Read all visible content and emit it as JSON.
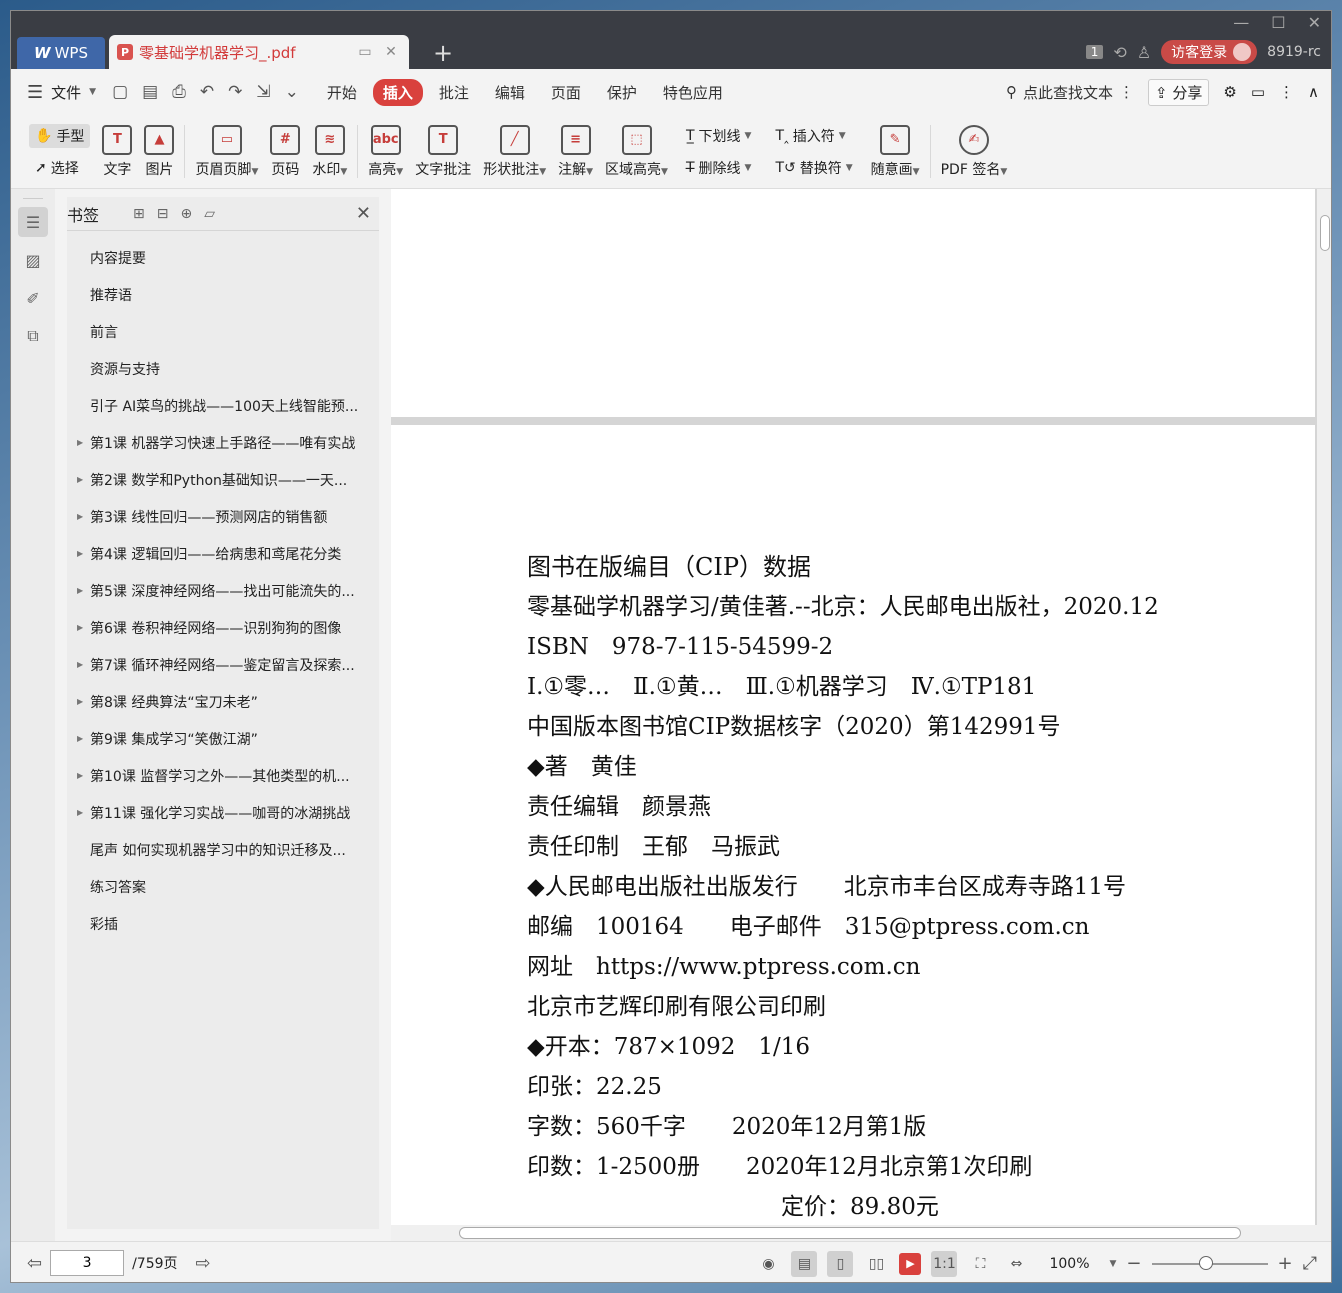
{
  "titlebar": {
    "app_tab": "WPS",
    "doc_tab": "零基础学机器学习_.pdf",
    "badge": "1",
    "login": "访客登录",
    "version": "8919-rc"
  },
  "menubar": {
    "file": "文件",
    "tabs": [
      "开始",
      "插入",
      "批注",
      "编辑",
      "页面",
      "保护",
      "特色应用"
    ],
    "active_tab": "插入",
    "search": "点此查找文本",
    "share": "分享"
  },
  "ribbon": {
    "hand": "手型",
    "select": "选择",
    "text": "文字",
    "image": "图片",
    "header_footer": "页眉页脚",
    "page_num": "页码",
    "watermark": "水印",
    "highlight": "高亮",
    "text_annot": "文字批注",
    "shape_annot": "形状批注",
    "note": "注解",
    "area_highlight": "区域高亮",
    "underline": "下划线",
    "strikethrough": "删除线",
    "insert_char": "插入符",
    "replace_char": "替换符",
    "freehand": "随意画",
    "pdf_sign": "PDF 签名"
  },
  "bookmarks": {
    "title": "书签",
    "items": [
      {
        "label": "内容提要",
        "expand": false
      },
      {
        "label": "推荐语",
        "expand": false
      },
      {
        "label": "前言",
        "expand": false
      },
      {
        "label": "资源与支持",
        "expand": false
      },
      {
        "label": "引子 AI菜鸟的挑战——100天上线智能预...",
        "expand": false
      },
      {
        "label": "第1课 机器学习快速上手路径——唯有实战",
        "expand": true
      },
      {
        "label": "第2课 数学和Python基础知识——一天...",
        "expand": true
      },
      {
        "label": "第3课 线性回归——预测网店的销售额",
        "expand": true
      },
      {
        "label": "第4课 逻辑回归——给病患和鸢尾花分类",
        "expand": true
      },
      {
        "label": "第5课 深度神经网络——找出可能流失的...",
        "expand": true
      },
      {
        "label": "第6课 卷积神经网络——识别狗狗的图像",
        "expand": true
      },
      {
        "label": "第7课 循环神经网络——鉴定留言及探索...",
        "expand": true
      },
      {
        "label": "第8课 经典算法“宝刀未老”",
        "expand": true
      },
      {
        "label": "第9课 集成学习“笑傲江湖”",
        "expand": true
      },
      {
        "label": "第10课 监督学习之外——其他类型的机...",
        "expand": true
      },
      {
        "label": "第11课 强化学习实战——咖哥的冰湖挑战",
        "expand": true
      },
      {
        "label": "尾声 如何实现机器学习中的知识迁移及...",
        "expand": false
      },
      {
        "label": "练习答案",
        "expand": false
      },
      {
        "label": "彩插",
        "expand": false
      }
    ]
  },
  "document": {
    "lines": [
      "图书在版编目（CIP）数据",
      "零基础学机器学习/黄佳著.--北京：人民邮电出版社，2020.12",
      "ISBN　978-7-115-54599-2",
      "Ⅰ.①零…　Ⅱ.①黄…　Ⅲ.①机器学习　Ⅳ.①TP181",
      "中国版本图书馆CIP数据核字（2020）第142991号",
      "◆著　黄佳",
      "责任编辑　颜景燕",
      "责任印制　王郁　马振武",
      "◆人民邮电出版社出版发行　　北京市丰台区成寿寺路11号",
      "邮编　100164　　电子邮件　315@ptpress.com.cn",
      "网址　https://www.ptpress.com.cn",
      "北京市艺辉印刷有限公司印刷",
      "◆开本：787×1092　1/16",
      "印张：22.25",
      "字数：560千字　　2020年12月第1版",
      "印数：1-2500册　　2020年12月北京第1次印刷"
    ],
    "price": "定价：89.80元"
  },
  "statusbar": {
    "current_page": "3",
    "total_pages": "/759页",
    "zoom": "100%",
    "zoom_fraction": 0.47
  }
}
